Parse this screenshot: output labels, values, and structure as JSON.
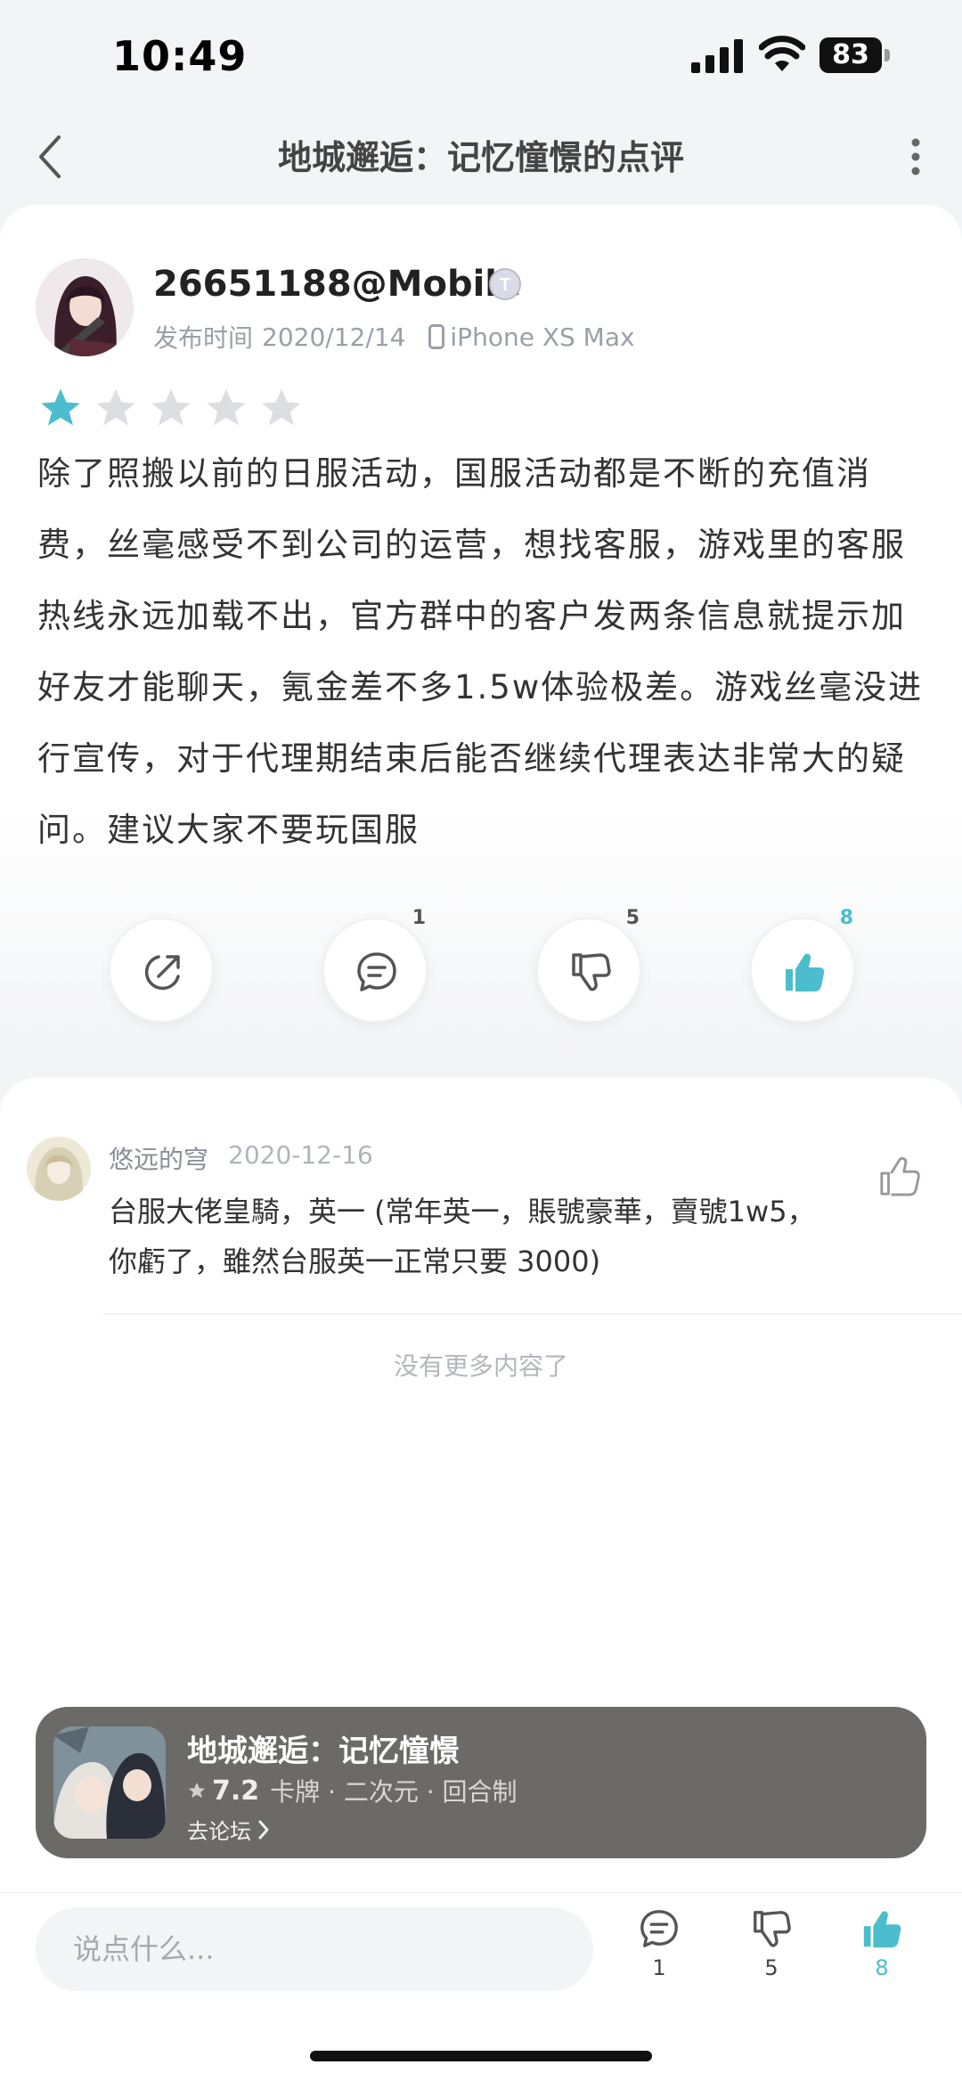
{
  "status_bar": {
    "time": "10:49",
    "battery": "83"
  },
  "nav": {
    "title": "地城邂逅：记忆憧憬的点评"
  },
  "review": {
    "author": "26651188@Mobile",
    "badge": "T",
    "published_label": "发布时间",
    "published_date": "2020/12/14",
    "device": "iPhone XS Max",
    "rating": 1,
    "rating_max": 5,
    "text": "除了照搬以前的日服活动，国服活动都是不断的充值消费，丝毫感受不到公司的运营，想找客服，游戏里的客服热线永远加载不出，官方群中的客户发两条信息就提示加好友才能聊天，氪金差不多1.5w体验极差。游戏丝毫没进行宣传，对于代理期结束后能否继续代理表达非常大的疑问。建议大家不要玩国服",
    "comment_count": "1",
    "dislike_count": "5",
    "like_count": "8"
  },
  "comments": [
    {
      "user": "悠远的穹",
      "date": "2020-12-16",
      "text": "台服大佬皇騎，英一 (常年英一，賬號豪華，賣號1w5，你虧了，雖然台服英一正常只要 3000)"
    }
  ],
  "no_more_text": "没有更多内容了",
  "game": {
    "name": "地城邂逅：记忆憧憬",
    "rating": "7.2",
    "tags": "卡牌 · 二次元 · 回合制",
    "forum_link": "去论坛"
  },
  "bottom_bar": {
    "input_placeholder": "说点什么...",
    "comment_count": "1",
    "dislike_count": "5",
    "like_count": "8"
  },
  "colors": {
    "accent": "#4cbdcc",
    "star_empty": "#dcdee1",
    "banner_bg": "#6b6a66"
  }
}
